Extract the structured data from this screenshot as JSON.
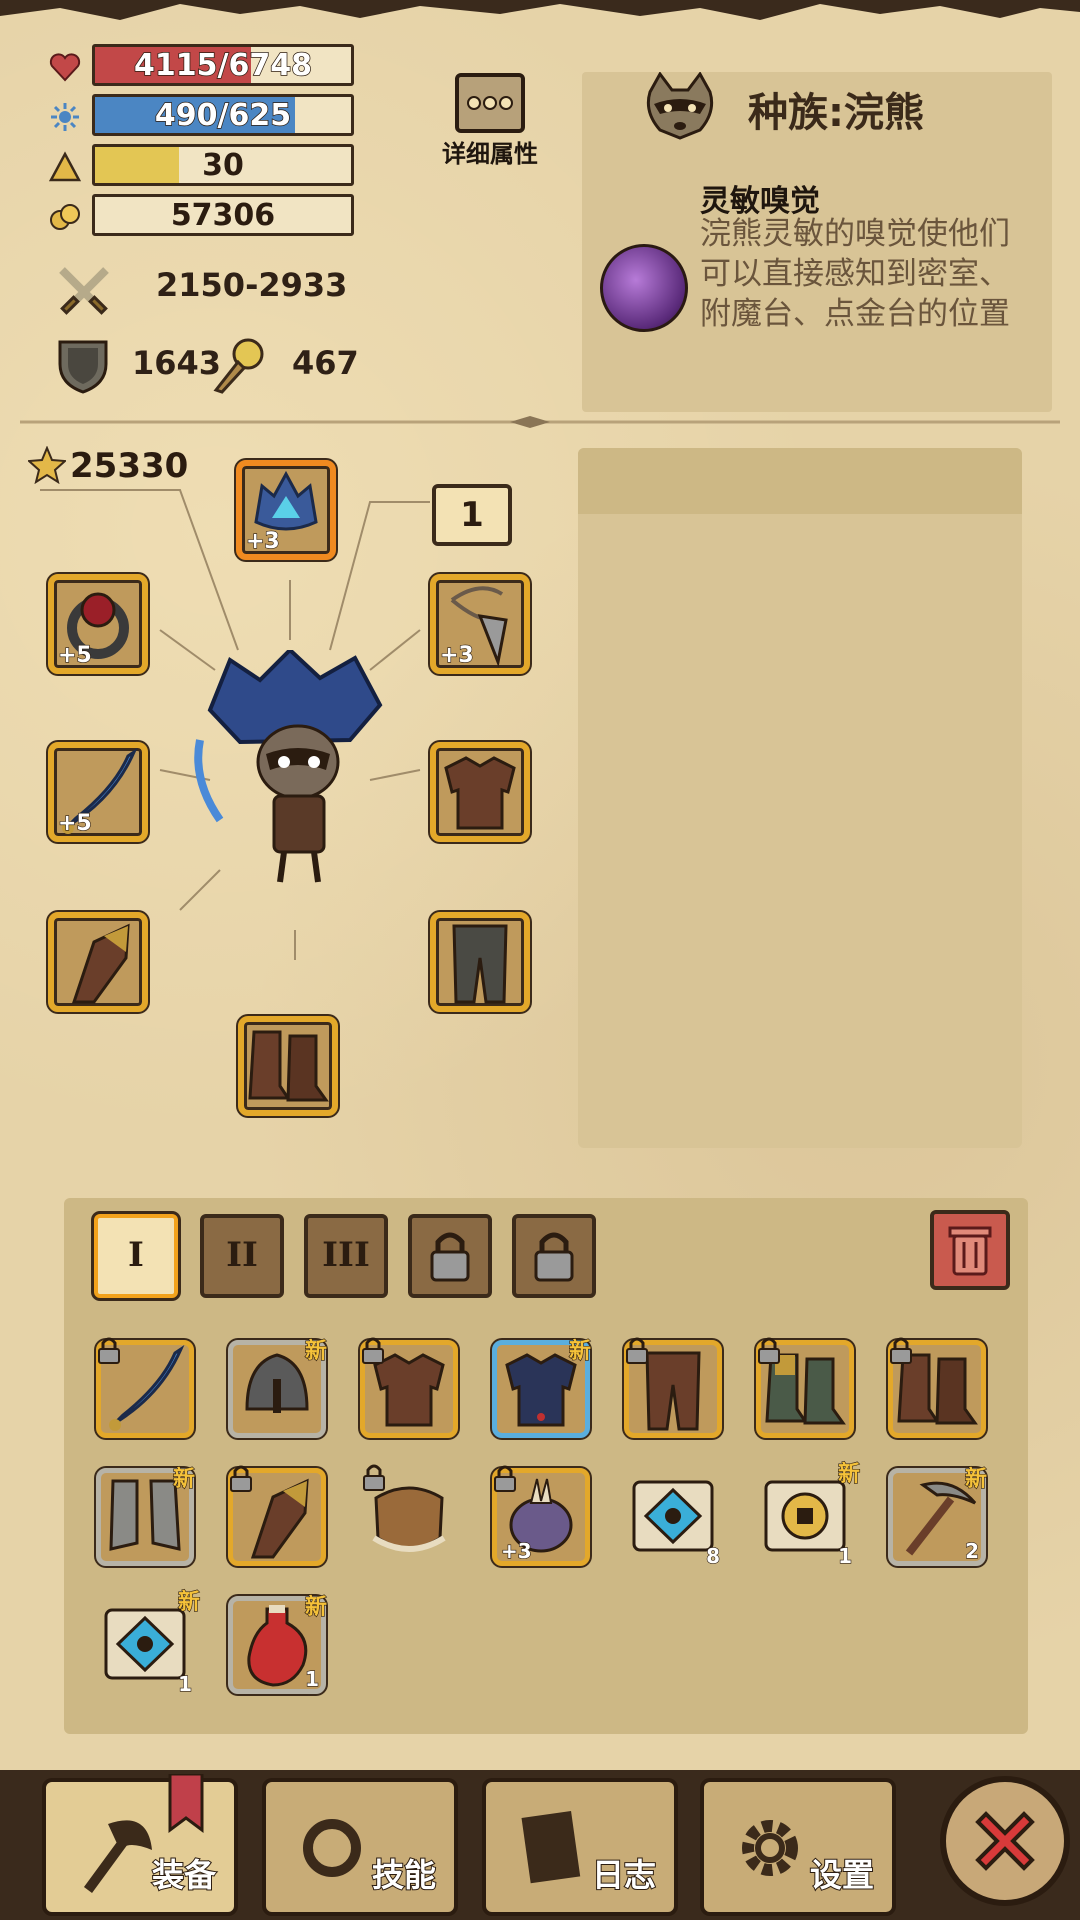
{
  "stats": {
    "hp": {
      "text": "4115/6748",
      "fraction": 0.61,
      "color": "#c24848",
      "icon": "heart-icon"
    },
    "mp": {
      "text": "490/625",
      "fraction": 0.78,
      "color": "#4b86c3",
      "icon": "mana-icon"
    },
    "level": {
      "text": "30",
      "fraction": 0.33,
      "color": "#e3c654",
      "icon": "level-triangle-icon"
    },
    "gold": {
      "text": "57306",
      "icon": "gold-icon"
    },
    "attack": "2150-2933",
    "defense": "1643",
    "magic_resist": "467"
  },
  "detail_button": {
    "label": "详细属性"
  },
  "race": {
    "title": "种族:浣熊",
    "trait_name": "灵敏嗅觉",
    "trait_desc": "浣熊灵敏的嗅觉使他们可以直接感知到密室、附魔台、点金台的位置"
  },
  "equipment": {
    "score": "25330",
    "page_badge": "1",
    "helmet_plus": "+3",
    "ring_plus": "+5",
    "amulet_plus": "+3",
    "weapon_plus": "+5"
  },
  "inventory": {
    "tabs": [
      "I",
      "II",
      "III",
      "",
      ""
    ],
    "new_label": "新",
    "rows": [
      [
        {
          "lock": true
        },
        {
          "new": true
        },
        {
          "lock": true
        },
        {
          "new": true
        },
        {
          "lock": true
        },
        {
          "lock": true
        },
        {
          "lock": true
        }
      ],
      [
        {
          "new": true
        },
        {
          "lock": true
        },
        {
          "lock": true
        },
        {
          "lock": true,
          "lvl": "+3"
        },
        {
          "cnt": "8"
        },
        {
          "new": true,
          "cnt": "1"
        },
        {
          "new": true,
          "cnt": "2"
        }
      ],
      [
        {
          "new": true,
          "cnt": "1"
        },
        {
          "new": true,
          "cnt": "1"
        }
      ]
    ]
  },
  "nav": {
    "equip": "装备",
    "skills": "技能",
    "journal": "日志",
    "settings": "设置"
  }
}
